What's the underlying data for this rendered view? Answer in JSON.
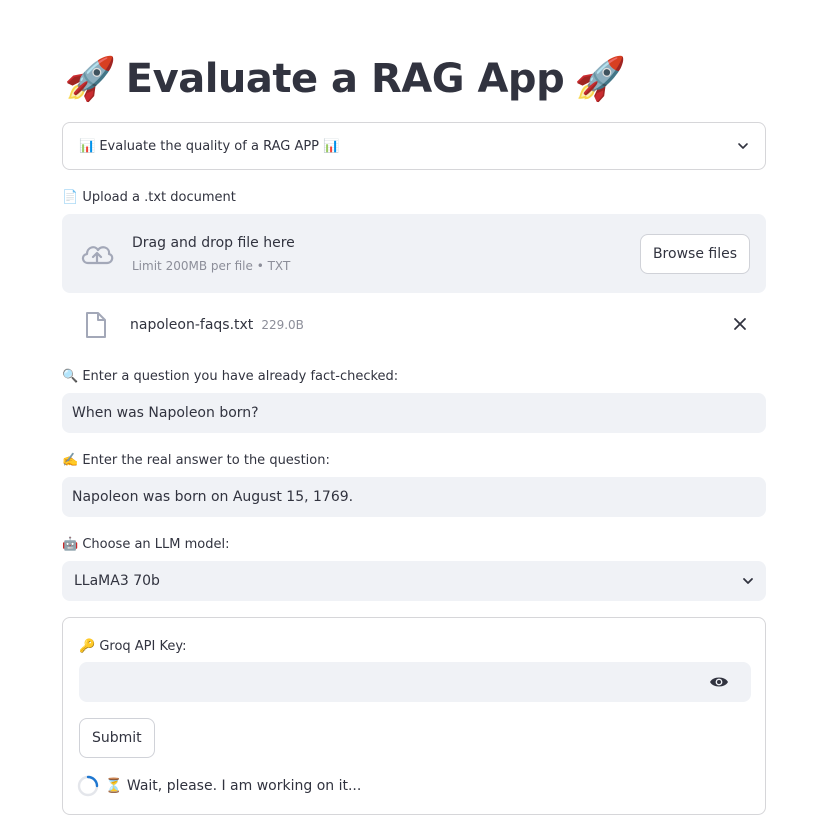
{
  "header": {
    "title": "Evaluate a RAG App",
    "emoji_left": "🚀",
    "emoji_right": "🚀"
  },
  "expander": {
    "label": "📊 Evaluate the quality of a RAG APP 📊"
  },
  "upload": {
    "label": "📄 Upload a .txt document",
    "drop_title": "Drag and drop file here",
    "drop_subtitle": "Limit 200MB per file • TXT",
    "browse_label": "Browse files",
    "file_name": "napoleon-faqs.txt",
    "file_size": "229.0B"
  },
  "question": {
    "label": "🔍 Enter a question you have already fact-checked:",
    "value": "When was Napoleon born?"
  },
  "answer": {
    "label": "✍️ Enter the real answer to the question:",
    "value": "Napoleon was born on August 15, 1769."
  },
  "model": {
    "label": "🤖 Choose an LLM model:",
    "selected": "LLaMA3 70b"
  },
  "form": {
    "api_key_label": "🔑 Groq API Key:",
    "api_key_value": "",
    "submit_label": "Submit",
    "status_text": "⏳ Wait, please. I am working on it..."
  },
  "colors": {
    "input_bg": "#f0f2f6",
    "border": "#d6d6d9",
    "text": "#31333f",
    "muted": "#8c8e99",
    "spinner": "#1f77d0"
  }
}
